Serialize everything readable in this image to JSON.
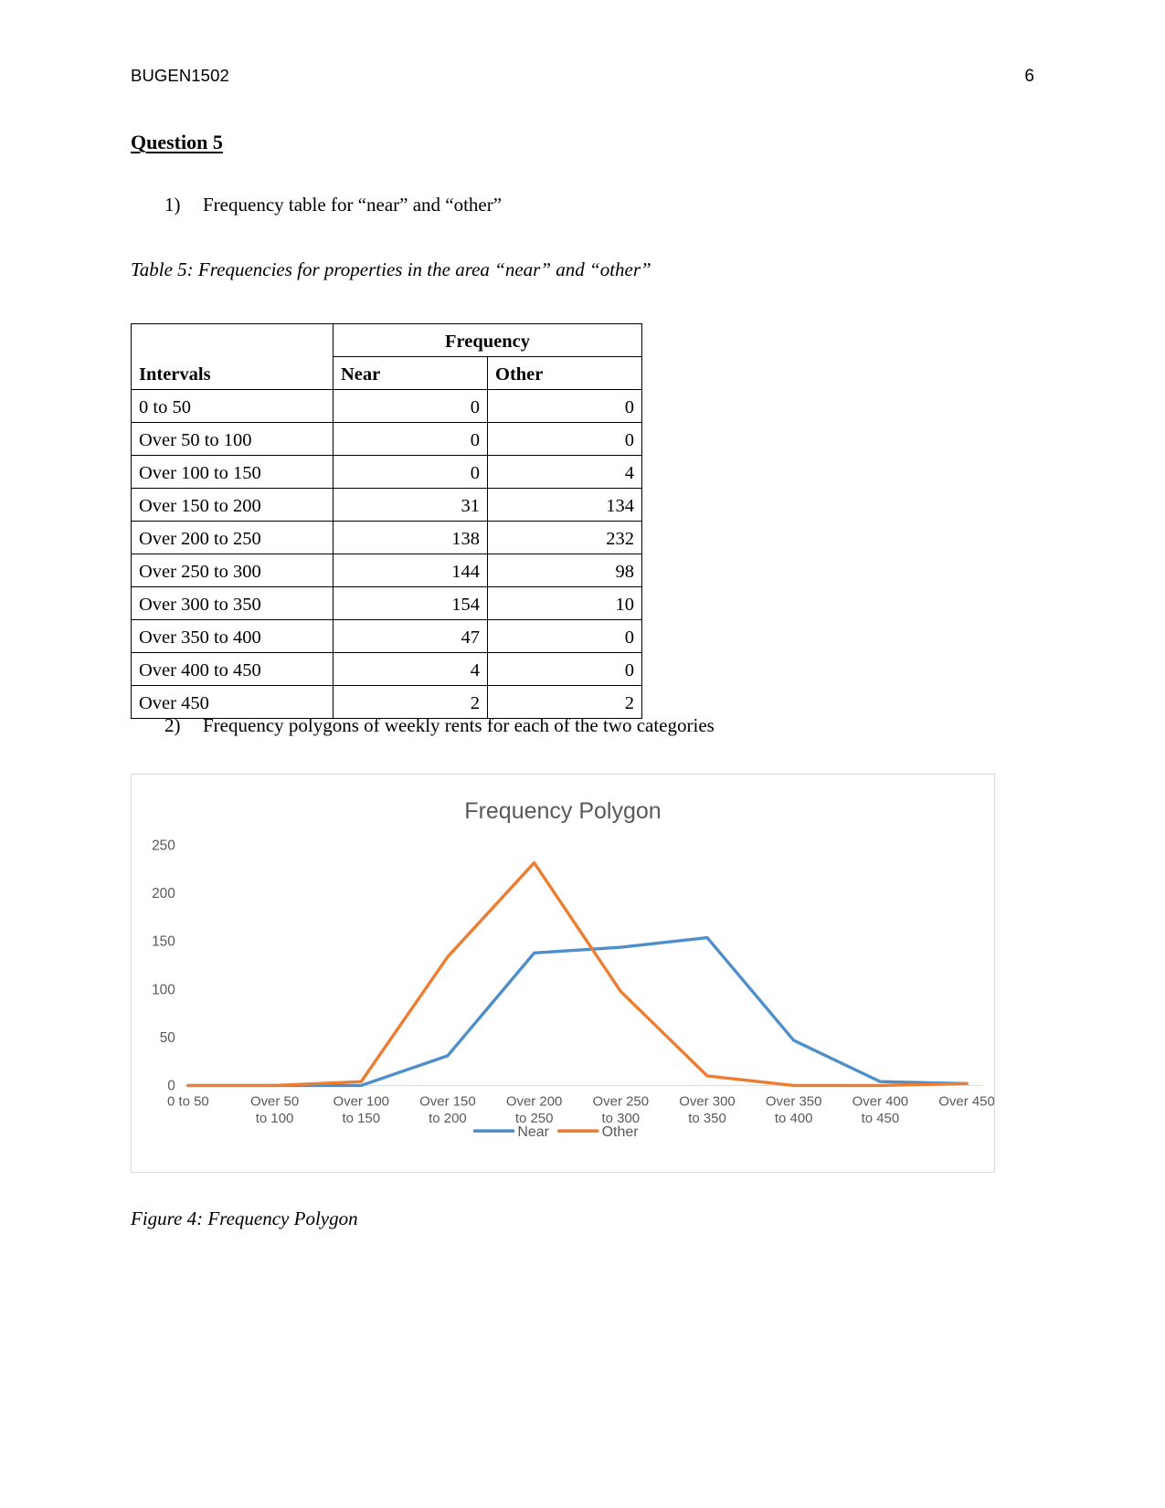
{
  "header": {
    "course_code": "BUGEN1502",
    "page_number": "6"
  },
  "question": {
    "title": "Question 5",
    "item1_marker": "1)",
    "item1_text": "Frequency table for “near” and “other”",
    "item2_marker": "2)",
    "item2_text": "Frequency polygons of weekly rents for each of the two categories"
  },
  "table": {
    "caption": "Table 5: Frequencies for properties in the area “near” and “other”",
    "group_header": "Frequency",
    "col_intervals": "Intervals",
    "col_near": "Near",
    "col_other": "Other",
    "rows": [
      {
        "interval": "0 to 50",
        "near": "0",
        "other": "0"
      },
      {
        "interval": "Over 50 to 100",
        "near": "0",
        "other": "0"
      },
      {
        "interval": "Over 100 to 150",
        "near": "0",
        "other": "4"
      },
      {
        "interval": "Over 150 to 200",
        "near": "31",
        "other": "134"
      },
      {
        "interval": "Over 200 to 250",
        "near": "138",
        "other": "232"
      },
      {
        "interval": "Over 250 to 300",
        "near": "144",
        "other": "98"
      },
      {
        "interval": "Over 300 to 350",
        "near": "154",
        "other": "10"
      },
      {
        "interval": "Over 350 to 400",
        "near": "47",
        "other": "0"
      },
      {
        "interval": "Over 400 to 450",
        "near": "4",
        "other": "0"
      },
      {
        "interval": "Over 450",
        "near": "2",
        "other": "2"
      }
    ]
  },
  "figure": {
    "caption": "Figure 4: Frequency Polygon"
  },
  "chart_data": {
    "type": "line",
    "title": "Frequency Polygon",
    "xlabel": "",
    "ylabel": "",
    "ylim": [
      0,
      250
    ],
    "yticks": [
      0,
      50,
      100,
      150,
      200,
      250
    ],
    "grid": false,
    "legend_position": "bottom",
    "categories": [
      "0 to 50",
      "Over 50 to 100",
      "Over 100 to 150",
      "Over 150 to 200",
      "Over 200 to 250",
      "Over 250 to 300",
      "Over 300 to 350",
      "Over 350 to 400",
      "Over 400 to 450",
      "Over 450"
    ],
    "series": [
      {
        "name": "Near",
        "color": "#4E8FCB",
        "values": [
          0,
          0,
          0,
          31,
          138,
          144,
          154,
          47,
          4,
          2
        ]
      },
      {
        "name": "Other",
        "color": "#ED7D31",
        "values": [
          0,
          0,
          4,
          134,
          232,
          98,
          10,
          0,
          0,
          2
        ]
      }
    ]
  }
}
